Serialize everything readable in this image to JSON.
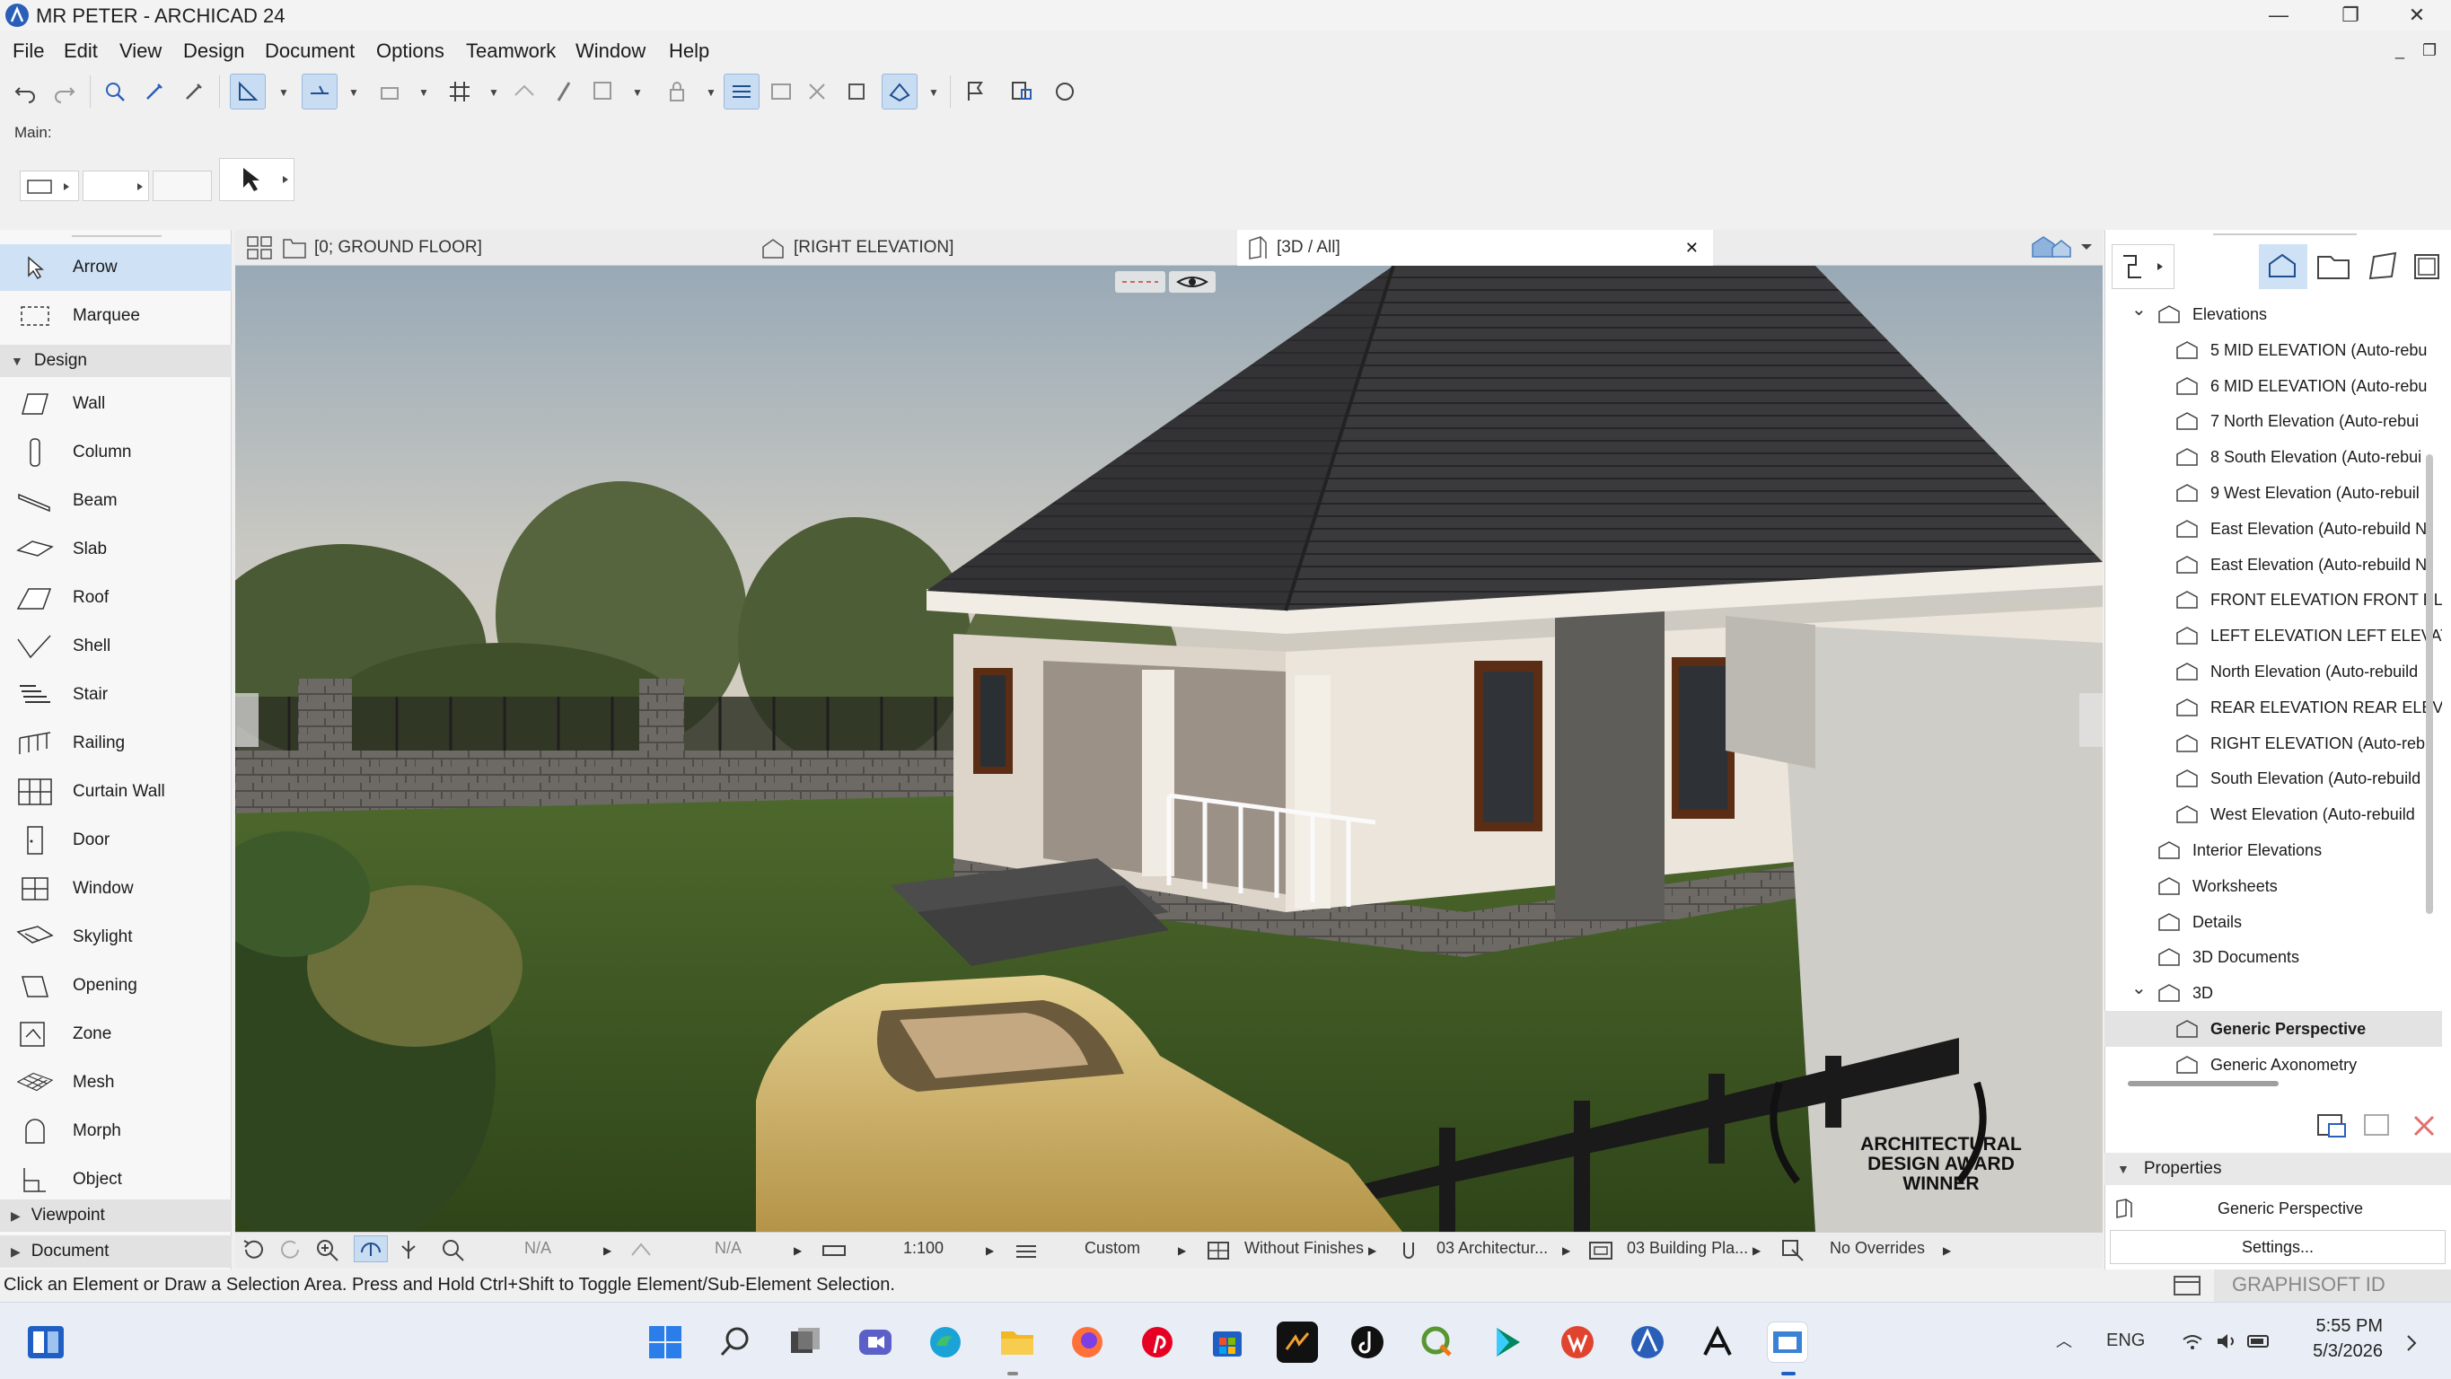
{
  "window": {
    "title": "MR PETER - ARCHICAD 24"
  },
  "window_controls": {
    "minimize": "—",
    "restore": "❐",
    "close": "✕",
    "mdi_minimize": "_",
    "mdi_restore": "❐"
  },
  "menu": [
    "File",
    "Edit",
    "View",
    "Design",
    "Document",
    "Options",
    "Teamwork",
    "Window",
    "Help"
  ],
  "infobox": {
    "label": "Main:"
  },
  "toolbox": {
    "tools_top": [
      {
        "label": "Arrow",
        "icon": "arrow-icon",
        "selected": true
      },
      {
        "label": "Marquee",
        "icon": "marquee-icon",
        "selected": false
      }
    ],
    "design_section": "Design",
    "design_tools": [
      {
        "label": "Wall",
        "icon": "wall-icon"
      },
      {
        "label": "Column",
        "icon": "column-icon"
      },
      {
        "label": "Beam",
        "icon": "beam-icon"
      },
      {
        "label": "Slab",
        "icon": "slab-icon"
      },
      {
        "label": "Roof",
        "icon": "roof-icon"
      },
      {
        "label": "Shell",
        "icon": "shell-icon"
      },
      {
        "label": "Stair",
        "icon": "stair-icon"
      },
      {
        "label": "Railing",
        "icon": "railing-icon"
      },
      {
        "label": "Curtain Wall",
        "icon": "curtain-wall-icon"
      },
      {
        "label": "Door",
        "icon": "door-icon"
      },
      {
        "label": "Window",
        "icon": "window-icon"
      },
      {
        "label": "Skylight",
        "icon": "skylight-icon"
      },
      {
        "label": "Opening",
        "icon": "opening-icon"
      },
      {
        "label": "Zone",
        "icon": "zone-icon"
      },
      {
        "label": "Mesh",
        "icon": "mesh-icon"
      },
      {
        "label": "Morph",
        "icon": "morph-icon"
      },
      {
        "label": "Object",
        "icon": "object-icon"
      }
    ],
    "collapsed_sections": [
      "Viewpoint",
      "Document"
    ]
  },
  "tabs": [
    {
      "label": "[0; GROUND FLOOR]",
      "icon": "floor-plan-icon",
      "active": false
    },
    {
      "label": "[RIGHT ELEVATION]",
      "icon": "elevation-icon",
      "active": false
    },
    {
      "label": "[3D / All]",
      "icon": "3d-icon",
      "active": true
    }
  ],
  "tab_close": "✕",
  "viewport": {
    "badge_lines": [
      "ARCHITECTURAL",
      "DESIGN AWARD",
      "WINNER"
    ]
  },
  "viewbar": {
    "na1": "N/A",
    "na2": "N/A",
    "scale": "1:100",
    "structure": "Custom",
    "finishes": "Without Finishes",
    "pen_set": "03 Architectur...",
    "model_view": "03 Building Pla...",
    "overrides": "No Overrides"
  },
  "navigator": {
    "items": [
      {
        "label": "Elevations",
        "level": 0,
        "expander": "⌄",
        "icon": "elevation-folder-icon"
      },
      {
        "label": "5 MID ELEVATION (Auto-rebu",
        "level": 1,
        "icon": "elevation-icon"
      },
      {
        "label": "6 MID ELEVATION (Auto-rebu",
        "level": 1,
        "icon": "elevation-icon"
      },
      {
        "label": "7 North Elevation (Auto-rebui",
        "level": 1,
        "icon": "elevation-icon"
      },
      {
        "label": "8 South Elevation (Auto-rebui",
        "level": 1,
        "icon": "elevation-icon"
      },
      {
        "label": "9 West Elevation (Auto-rebuil",
        "level": 1,
        "icon": "elevation-icon"
      },
      {
        "label": "East Elevation (Auto-rebuild N",
        "level": 1,
        "icon": "elevation-icon"
      },
      {
        "label": "East Elevation (Auto-rebuild N",
        "level": 1,
        "icon": "elevation-icon"
      },
      {
        "label": "FRONT ELEVATION FRONT EL",
        "level": 1,
        "icon": "elevation-icon"
      },
      {
        "label": "LEFT ELEVATION LEFT ELEVAT",
        "level": 1,
        "icon": "elevation-icon"
      },
      {
        "label": "North Elevation (Auto-rebuild",
        "level": 1,
        "icon": "elevation-icon"
      },
      {
        "label": "REAR ELEVATION REAR ELEVA",
        "level": 1,
        "icon": "elevation-icon"
      },
      {
        "label": "RIGHT ELEVATION (Auto-rebu",
        "level": 1,
        "icon": "elevation-icon"
      },
      {
        "label": "South Elevation (Auto-rebuild",
        "level": 1,
        "icon": "elevation-icon"
      },
      {
        "label": "West Elevation (Auto-rebuild",
        "level": 1,
        "icon": "elevation-icon"
      },
      {
        "label": "Interior Elevations",
        "level": 0,
        "icon": "interior-elevation-icon"
      },
      {
        "label": "Worksheets",
        "level": 0,
        "icon": "worksheet-icon"
      },
      {
        "label": "Details",
        "level": 0,
        "icon": "detail-icon"
      },
      {
        "label": "3D Documents",
        "level": 0,
        "icon": "3d-document-icon"
      },
      {
        "label": "3D",
        "level": 0,
        "expander": "⌄",
        "icon": "3d-folder-icon"
      },
      {
        "label": "Generic Perspective",
        "level": 1,
        "icon": "perspective-icon",
        "selected": true
      },
      {
        "label": "Generic Axonometry",
        "level": 1,
        "icon": "axonometry-icon"
      }
    ],
    "properties_label": "Properties",
    "properties_value": "Generic Perspective",
    "settings_button": "Settings...",
    "graphisoft_id": "GRAPHISOFT ID"
  },
  "status": {
    "text": "Click an Element or Draw a Selection Area. Press and Hold Ctrl+Shift to Toggle Element/Sub-Element Selection."
  },
  "taskbar": {
    "language": "ENG",
    "time": "5:55 PM",
    "date": "5/3/2026",
    "apps": [
      "windows-start-icon",
      "search-icon",
      "task-view-icon",
      "video-call-icon",
      "edge-icon",
      "file-explorer-icon",
      "firefox-icon",
      "pinterest-icon",
      "store-icon",
      "media-app-icon",
      "tiktok-icon",
      "qgis-icon",
      "play-icon",
      "wps-icon",
      "archicad-icon",
      "adobe-icon",
      "window-app-icon"
    ]
  },
  "colors": {
    "accent": "#2a5fb8",
    "selection": "#cfe1f5",
    "roof": "#3a3a3c",
    "wall": "#e8e2da"
  }
}
